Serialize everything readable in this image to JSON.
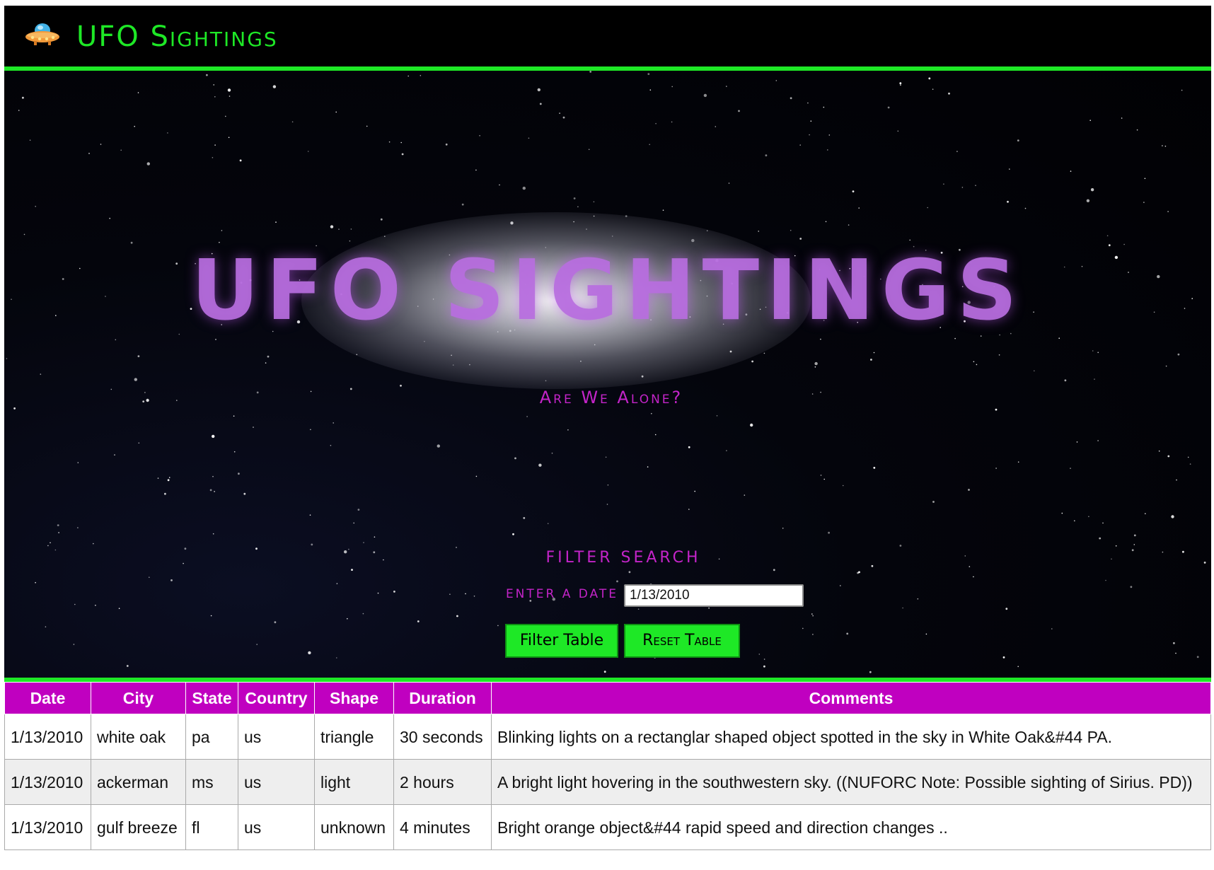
{
  "navbar": {
    "title": "UFO Sightings",
    "logo_icon": "ufo-icon"
  },
  "hero": {
    "title": "UFO SIGHTINGS",
    "subtitle": "Are We Alone?"
  },
  "filter": {
    "heading": "FILTER SEARCH",
    "date_label": "ENTER A DATE",
    "date_value": "1/13/2010",
    "filter_button_label": "Filter Table",
    "reset_button_label": "Reset Table"
  },
  "table": {
    "headers": [
      "Date",
      "City",
      "State",
      "Country",
      "Shape",
      "Duration",
      "Comments"
    ],
    "rows": [
      [
        "1/13/2010",
        "white oak",
        "pa",
        "us",
        "triangle",
        "30 seconds",
        "Blinking lights on a rectanglar shaped object spotted in the sky in White Oak&#44 PA."
      ],
      [
        "1/13/2010",
        "ackerman",
        "ms",
        "us",
        "light",
        "2 hours",
        "A bright light hovering in the southwestern sky. ((NUFORC Note: Possible sighting of Sirius. PD))"
      ],
      [
        "1/13/2010",
        "gulf breeze",
        "fl",
        "us",
        "unknown",
        "4 minutes",
        "Bright orange object&#44 rapid speed and direction changes .."
      ]
    ]
  },
  "colors": {
    "accent_green": "#1ee826",
    "accent_magenta": "#c000c0",
    "hero_title_purple": "#b76ede"
  }
}
